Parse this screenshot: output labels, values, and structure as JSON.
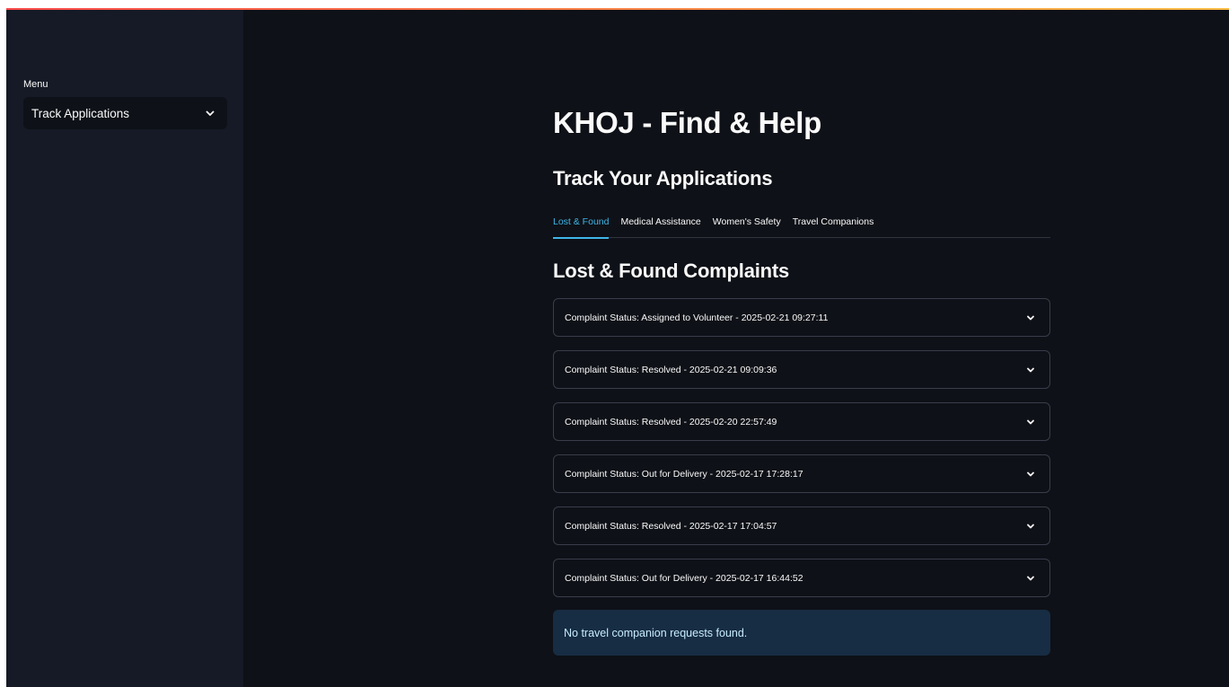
{
  "sidebar": {
    "label": "Menu",
    "select_value": "Track Applications"
  },
  "main": {
    "title": "KHOJ - Find & Help",
    "subtitle": "Track Your Applications",
    "tabs": [
      {
        "label": "Lost & Found",
        "active": true
      },
      {
        "label": "Medical Assistance",
        "active": false
      },
      {
        "label": "Women's Safety",
        "active": false
      },
      {
        "label": "Travel Companions",
        "active": false
      }
    ],
    "section_title": "Lost & Found Complaints",
    "complaints": [
      {
        "label": "Complaint Status: Assigned to Volunteer - 2025-02-21 09:27:11"
      },
      {
        "label": "Complaint Status: Resolved - 2025-02-21 09:09:36"
      },
      {
        "label": "Complaint Status: Resolved - 2025-02-20 22:57:49"
      },
      {
        "label": "Complaint Status: Out for Delivery - 2025-02-17 17:28:17"
      },
      {
        "label": "Complaint Status: Resolved - 2025-02-17 17:04:57"
      },
      {
        "label": "Complaint Status: Out for Delivery - 2025-02-17 16:44:52"
      }
    ],
    "info_message": "No travel companion requests found."
  },
  "colors": {
    "background": "#0e1117",
    "sidebar": "#151a26",
    "accent": "#3fb6e8",
    "info_bg": "#172d43",
    "info_text": "#c7ebff"
  },
  "icons": {
    "select_chevron": "chevron-down-icon",
    "expander_chevron": "chevron-down-icon"
  }
}
